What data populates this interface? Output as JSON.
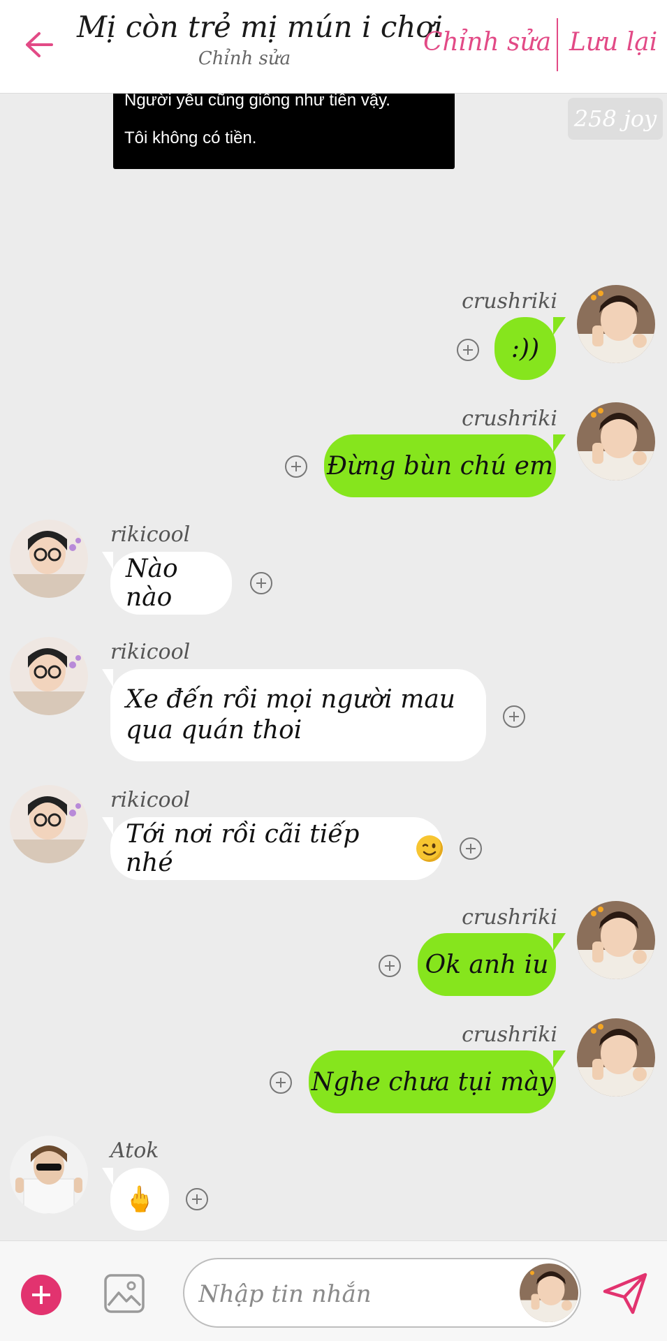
{
  "header": {
    "title": "Mị còn trẻ mị mún i chơi",
    "subtitle": "Chỉnh sửa",
    "edit_label": "Chỉnh sửa",
    "save_label": "Lưu lại",
    "accent_color": "#e24a86"
  },
  "pinned_message": {
    "line1": "Người yêu cũng giống như tiền vậy.",
    "line2": "Tôi không có tiền."
  },
  "joy_badge": "258 joy",
  "messages": [
    {
      "sender": "crushriki",
      "side": "right",
      "text": ":))",
      "bubble_color": "#86e51d"
    },
    {
      "sender": "crushriki",
      "side": "right",
      "text": "Đừng bùn chú em",
      "bubble_color": "#86e51d"
    },
    {
      "sender": "rikicool",
      "side": "left",
      "text": "Nào nào",
      "bubble_color": "#ffffff"
    },
    {
      "sender": "rikicool",
      "side": "left",
      "line1": "Xe đến rồi mọi người mau",
      "line2": "qua quán thoi",
      "bubble_color": "#ffffff"
    },
    {
      "sender": "rikicool",
      "side": "left",
      "text": "Tới nơi rồi cãi tiếp nhé",
      "emoji": "winking-face",
      "bubble_color": "#ffffff"
    },
    {
      "sender": "crushriki",
      "side": "right",
      "text": "Ok anh iu",
      "bubble_color": "#86e51d"
    },
    {
      "sender": "crushriki",
      "side": "right",
      "text": "Nghe chưa tụi mày",
      "bubble_color": "#86e51d"
    },
    {
      "sender": "Atok",
      "side": "left",
      "text": "🖕",
      "bubble_color": "#ffffff"
    }
  ],
  "composer": {
    "placeholder": "Nhập tin nhắn",
    "add_color": "#e2336f",
    "send_color": "#e2336f"
  }
}
